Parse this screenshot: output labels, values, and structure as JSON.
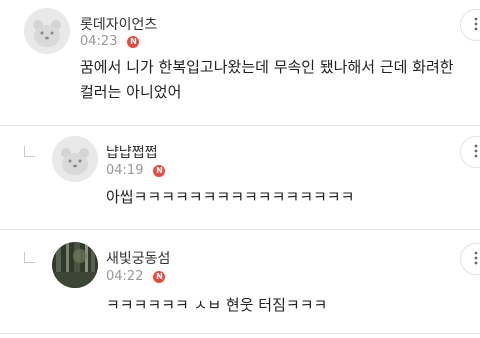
{
  "comments": [
    {
      "nickname": "롯데자이언츠",
      "time": "04:23",
      "new_badge": "N",
      "text_lines": [
        "꿈에서 니가 한복입고나왔는데 무속인 됐나해서 근데 화려한",
        "컬러는 아니었어"
      ],
      "is_reply": false,
      "more_icon": "more-vertical-icon"
    },
    {
      "nickname": "냡냡쩝쩝",
      "time": "04:19",
      "new_badge": "N",
      "text_lines": [
        "아씹ㅋㅋㅋㅋㅋㅋㅋㅋㅋㅋㅋㅋㅋㅋㅋㅋ"
      ],
      "is_reply": true,
      "more_icon": "more-vertical-icon"
    },
    {
      "nickname": "새빛궁동섬",
      "time": "04:22",
      "new_badge": "N",
      "text_lines": [
        "ㅋㅋㅋㅋㅋㅋ ㅅㅂ 현웃 터짐ㅋㅋㅋ"
      ],
      "is_reply": true,
      "more_icon": "more-vertical-icon"
    }
  ],
  "colors": {
    "badge": "#f0473c",
    "meta": "#999999",
    "divider": "#e6e6e6"
  }
}
